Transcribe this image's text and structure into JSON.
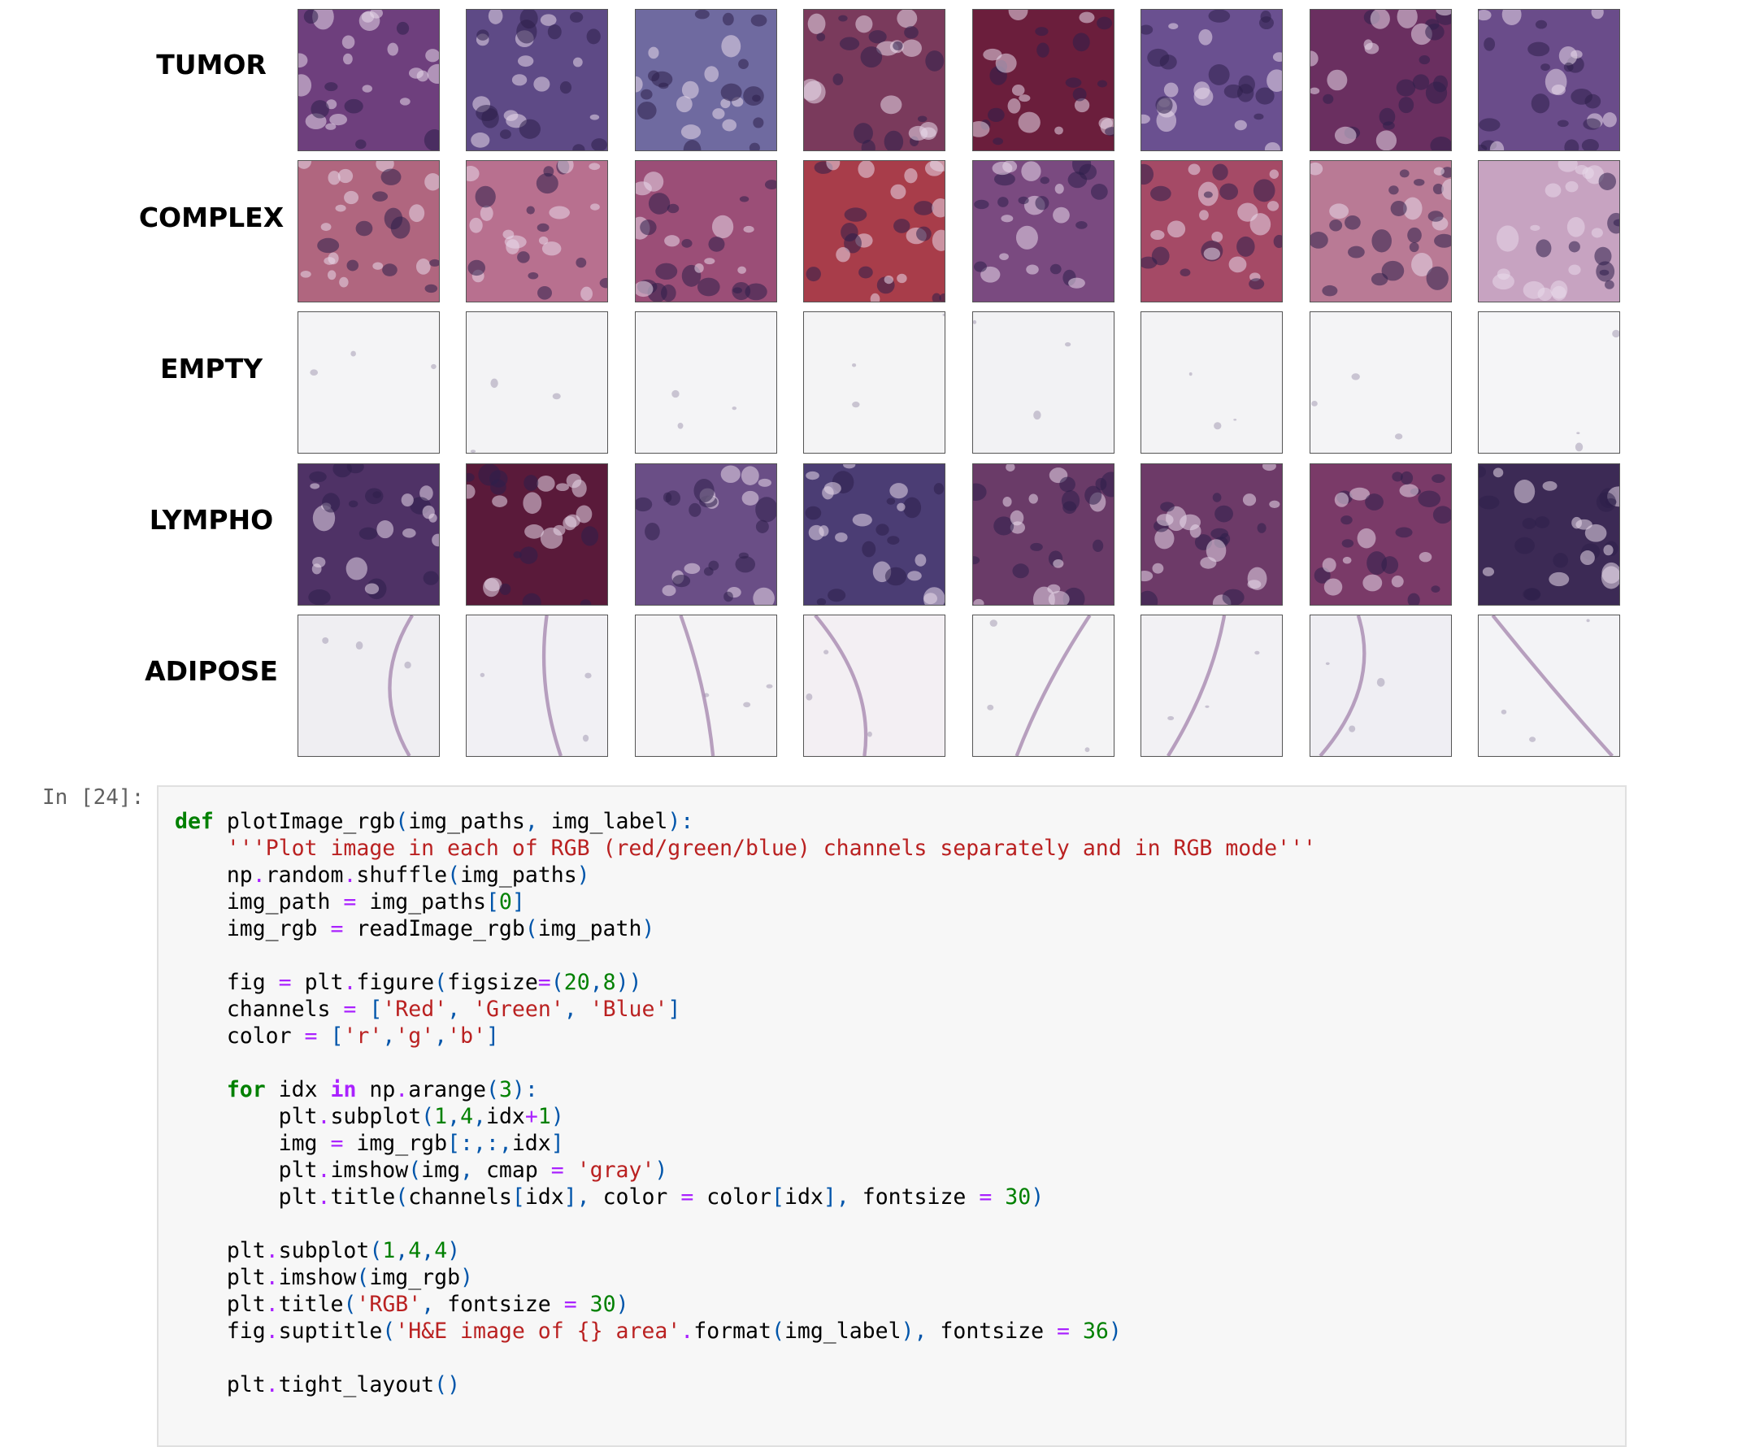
{
  "output": {
    "rows": [
      {
        "label": "TUMOR",
        "colors": [
          "#6e3f7d",
          "#5e4a86",
          "#6f6aa0",
          "#7a3a5c",
          "#6b1e3c",
          "#6a5090",
          "#6a2f60",
          "#6a4c8a"
        ]
      },
      {
        "label": "COMPLEX",
        "colors": [
          "#b0667f",
          "#b8708f",
          "#9b4e77",
          "#a83d4a",
          "#7a4a80",
          "#a54a66",
          "#b97a95",
          "#c7a3c1"
        ]
      },
      {
        "label": "EMPTY",
        "colors": [
          "#f4f4f6",
          "#f3f3f5",
          "#f4f4f6",
          "#f4f4f5",
          "#f2f2f4",
          "#f3f3f5",
          "#f4f4f6",
          "#f5f5f7"
        ]
      },
      {
        "label": "LYMPHO",
        "colors": [
          "#4f3266",
          "#5a1a3a",
          "#6a4e86",
          "#4b3d74",
          "#6a3b68",
          "#6d3a68",
          "#7a3a68",
          "#3c2a55"
        ]
      },
      {
        "label": "ADIPOSE",
        "colors": [
          "#efeef2",
          "#f1f0f4",
          "#f4f3f5",
          "#f3eff3",
          "#f4f4f5",
          "#f2f1f4",
          "#efeef3",
          "#f3f3f6"
        ]
      }
    ]
  },
  "cell": {
    "prompt": "In [24]:"
  }
}
